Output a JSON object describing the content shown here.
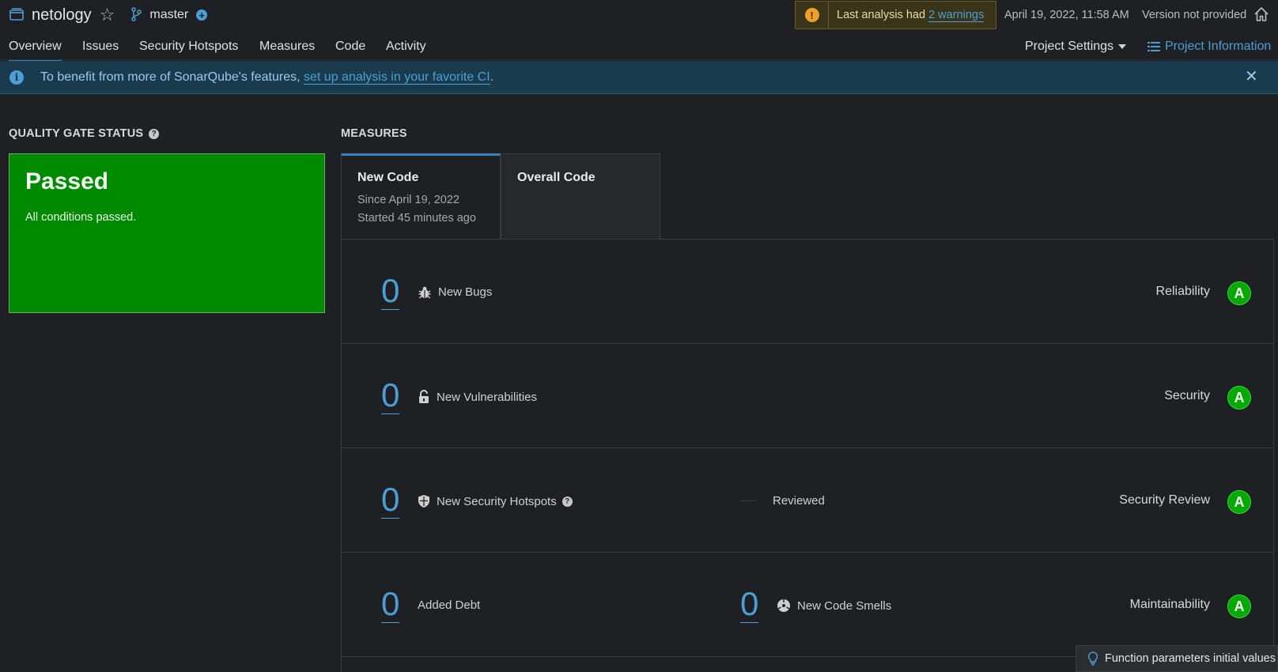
{
  "header": {
    "project_name": "netology",
    "branch_name": "master",
    "warning_prefix": "Last analysis had",
    "warning_link": "2 warnings",
    "analysis_date": "April 19, 2022, 11:58 AM",
    "version": "Version not provided"
  },
  "nav": {
    "tabs": [
      "Overview",
      "Issues",
      "Security Hotspots",
      "Measures",
      "Code",
      "Activity"
    ],
    "active_tab": "Overview",
    "project_settings": "Project Settings",
    "project_information": "Project Information"
  },
  "banner": {
    "text": "To benefit from more of SonarQube's features,",
    "link": "set up analysis in your favorite CI",
    "suffix": "."
  },
  "quality_gate": {
    "title": "QUALITY GATE STATUS",
    "status": "Passed",
    "description": "All conditions passed.",
    "color": "#008a00"
  },
  "measures": {
    "title": "MEASURES",
    "tabs": [
      {
        "title": "New Code",
        "line1": "Since April 19, 2022",
        "line2": "Started 45 minutes ago"
      },
      {
        "title": "Overall Code"
      }
    ],
    "rows": [
      {
        "value": "0",
        "label": "New Bugs",
        "icon": "bug-icon",
        "category": "Reliability",
        "rating": "A"
      },
      {
        "value": "0",
        "label": "New Vulnerabilities",
        "icon": "lock-icon",
        "category": "Security",
        "rating": "A"
      },
      {
        "value": "0",
        "label": "New Security Hotspots",
        "icon": "shield-icon",
        "extra_label": "Reviewed",
        "category": "Security Review",
        "rating": "A"
      },
      {
        "value": "0",
        "label": "Added Debt",
        "second_value": "0",
        "second_label": "New Code Smells",
        "icon": "code-smell-icon",
        "category": "Maintainability",
        "rating": "A"
      }
    ]
  },
  "toast": {
    "text": "Function parameters initial values"
  },
  "colors": {
    "accent": "#4b9fd5",
    "rating_a": "#00aa00",
    "warning": "#f0a02a"
  }
}
